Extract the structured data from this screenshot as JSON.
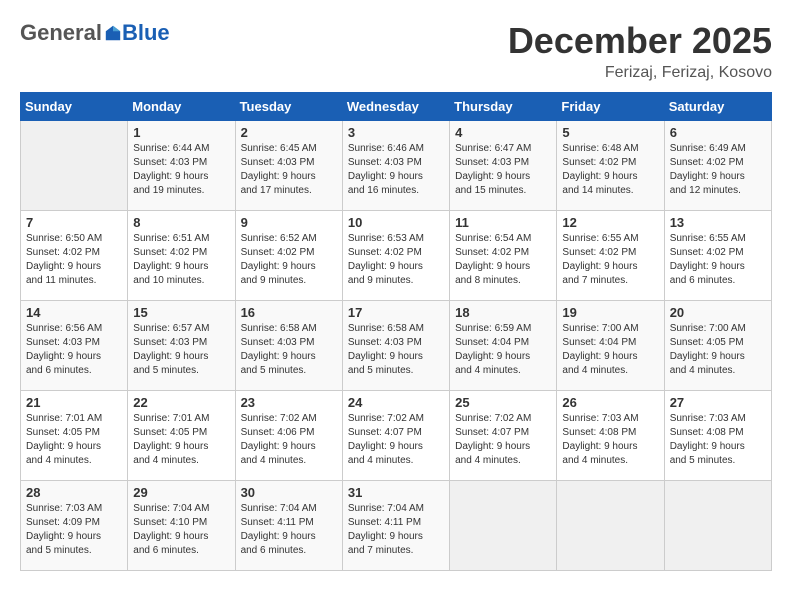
{
  "header": {
    "logo_general": "General",
    "logo_blue": "Blue",
    "month": "December 2025",
    "location": "Ferizaj, Ferizaj, Kosovo"
  },
  "weekdays": [
    "Sunday",
    "Monday",
    "Tuesday",
    "Wednesday",
    "Thursday",
    "Friday",
    "Saturday"
  ],
  "weeks": [
    [
      {
        "day": "",
        "info": ""
      },
      {
        "day": "1",
        "info": "Sunrise: 6:44 AM\nSunset: 4:03 PM\nDaylight: 9 hours\nand 19 minutes."
      },
      {
        "day": "2",
        "info": "Sunrise: 6:45 AM\nSunset: 4:03 PM\nDaylight: 9 hours\nand 17 minutes."
      },
      {
        "day": "3",
        "info": "Sunrise: 6:46 AM\nSunset: 4:03 PM\nDaylight: 9 hours\nand 16 minutes."
      },
      {
        "day": "4",
        "info": "Sunrise: 6:47 AM\nSunset: 4:03 PM\nDaylight: 9 hours\nand 15 minutes."
      },
      {
        "day": "5",
        "info": "Sunrise: 6:48 AM\nSunset: 4:02 PM\nDaylight: 9 hours\nand 14 minutes."
      },
      {
        "day": "6",
        "info": "Sunrise: 6:49 AM\nSunset: 4:02 PM\nDaylight: 9 hours\nand 12 minutes."
      }
    ],
    [
      {
        "day": "7",
        "info": "Sunrise: 6:50 AM\nSunset: 4:02 PM\nDaylight: 9 hours\nand 11 minutes."
      },
      {
        "day": "8",
        "info": "Sunrise: 6:51 AM\nSunset: 4:02 PM\nDaylight: 9 hours\nand 10 minutes."
      },
      {
        "day": "9",
        "info": "Sunrise: 6:52 AM\nSunset: 4:02 PM\nDaylight: 9 hours\nand 9 minutes."
      },
      {
        "day": "10",
        "info": "Sunrise: 6:53 AM\nSunset: 4:02 PM\nDaylight: 9 hours\nand 9 minutes."
      },
      {
        "day": "11",
        "info": "Sunrise: 6:54 AM\nSunset: 4:02 PM\nDaylight: 9 hours\nand 8 minutes."
      },
      {
        "day": "12",
        "info": "Sunrise: 6:55 AM\nSunset: 4:02 PM\nDaylight: 9 hours\nand 7 minutes."
      },
      {
        "day": "13",
        "info": "Sunrise: 6:55 AM\nSunset: 4:02 PM\nDaylight: 9 hours\nand 6 minutes."
      }
    ],
    [
      {
        "day": "14",
        "info": "Sunrise: 6:56 AM\nSunset: 4:03 PM\nDaylight: 9 hours\nand 6 minutes."
      },
      {
        "day": "15",
        "info": "Sunrise: 6:57 AM\nSunset: 4:03 PM\nDaylight: 9 hours\nand 5 minutes."
      },
      {
        "day": "16",
        "info": "Sunrise: 6:58 AM\nSunset: 4:03 PM\nDaylight: 9 hours\nand 5 minutes."
      },
      {
        "day": "17",
        "info": "Sunrise: 6:58 AM\nSunset: 4:03 PM\nDaylight: 9 hours\nand 5 minutes."
      },
      {
        "day": "18",
        "info": "Sunrise: 6:59 AM\nSunset: 4:04 PM\nDaylight: 9 hours\nand 4 minutes."
      },
      {
        "day": "19",
        "info": "Sunrise: 7:00 AM\nSunset: 4:04 PM\nDaylight: 9 hours\nand 4 minutes."
      },
      {
        "day": "20",
        "info": "Sunrise: 7:00 AM\nSunset: 4:05 PM\nDaylight: 9 hours\nand 4 minutes."
      }
    ],
    [
      {
        "day": "21",
        "info": "Sunrise: 7:01 AM\nSunset: 4:05 PM\nDaylight: 9 hours\nand 4 minutes."
      },
      {
        "day": "22",
        "info": "Sunrise: 7:01 AM\nSunset: 4:05 PM\nDaylight: 9 hours\nand 4 minutes."
      },
      {
        "day": "23",
        "info": "Sunrise: 7:02 AM\nSunset: 4:06 PM\nDaylight: 9 hours\nand 4 minutes."
      },
      {
        "day": "24",
        "info": "Sunrise: 7:02 AM\nSunset: 4:07 PM\nDaylight: 9 hours\nand 4 minutes."
      },
      {
        "day": "25",
        "info": "Sunrise: 7:02 AM\nSunset: 4:07 PM\nDaylight: 9 hours\nand 4 minutes."
      },
      {
        "day": "26",
        "info": "Sunrise: 7:03 AM\nSunset: 4:08 PM\nDaylight: 9 hours\nand 4 minutes."
      },
      {
        "day": "27",
        "info": "Sunrise: 7:03 AM\nSunset: 4:08 PM\nDaylight: 9 hours\nand 5 minutes."
      }
    ],
    [
      {
        "day": "28",
        "info": "Sunrise: 7:03 AM\nSunset: 4:09 PM\nDaylight: 9 hours\nand 5 minutes."
      },
      {
        "day": "29",
        "info": "Sunrise: 7:04 AM\nSunset: 4:10 PM\nDaylight: 9 hours\nand 6 minutes."
      },
      {
        "day": "30",
        "info": "Sunrise: 7:04 AM\nSunset: 4:11 PM\nDaylight: 9 hours\nand 6 minutes."
      },
      {
        "day": "31",
        "info": "Sunrise: 7:04 AM\nSunset: 4:11 PM\nDaylight: 9 hours\nand 7 minutes."
      },
      {
        "day": "",
        "info": ""
      },
      {
        "day": "",
        "info": ""
      },
      {
        "day": "",
        "info": ""
      }
    ]
  ]
}
